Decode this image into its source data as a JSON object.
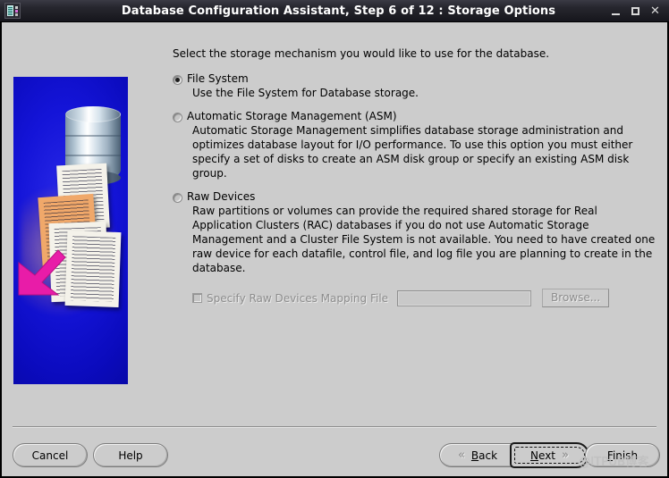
{
  "window": {
    "title": "Database Configuration Assistant, Step 6 of 12 : Storage Options",
    "icon": "database-config-app-icon",
    "controls": {
      "minimize": "_",
      "maximize": "□",
      "close": "✕"
    }
  },
  "content": {
    "intro": "Select the storage mechanism you would like to use for the database.",
    "options": [
      {
        "id": "file-system",
        "label": "File System",
        "selected": true,
        "description": "Use the File System for Database storage."
      },
      {
        "id": "asm",
        "label": "Automatic Storage Management (ASM)",
        "selected": false,
        "description": "Automatic Storage Management simplifies database storage administration and optimizes database layout for I/O performance.  To use this option you must either specify a set of disks to create an ASM disk group or specify an existing ASM disk group."
      },
      {
        "id": "raw-devices",
        "label": "Raw Devices",
        "selected": false,
        "description": "Raw partitions or volumes can provide the required shared storage for Real Application Clusters (RAC) databases if you do not use Automatic Storage Management and a Cluster File System is not available.  You need to have created one raw device for each datafile, control file, and log file you are planning to create in the database."
      }
    ],
    "raw_mapping": {
      "checkbox_label": "Specify Raw Devices Mapping File",
      "checked": false,
      "enabled": false,
      "input_value": "",
      "input_placeholder": "",
      "browse_label": "Browse..."
    }
  },
  "buttons": {
    "cancel": "Cancel",
    "help": "Help",
    "back": "Back",
    "back_icon": "«",
    "next": "Next",
    "next_icon": "»",
    "finish": "Finish",
    "focused": "next"
  },
  "watermark": "@ITPUB博客",
  "colors": {
    "window_bg": "#cccccc",
    "titlebar_bg": "#1b1b22",
    "titlebar_text": "#ffffff",
    "art_blue": "#1414d8",
    "arrow_magenta": "#e81ca8",
    "sheet_orange": "#f0a86a",
    "disabled_text": "#8d8d8d"
  },
  "art": {
    "description": "database-storage-illustration",
    "elements": [
      "database-cylinder",
      "document-sheets",
      "magenta-arrow"
    ]
  }
}
